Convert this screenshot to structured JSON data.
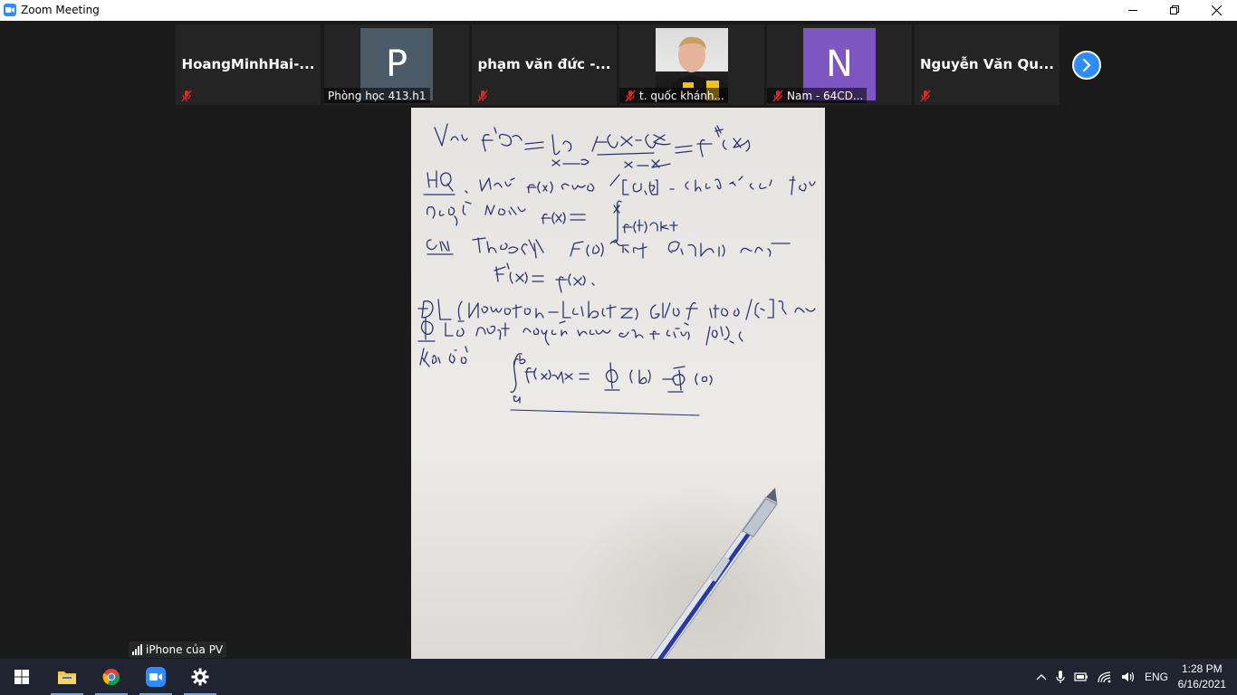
{
  "window": {
    "title": "Zoom Meeting"
  },
  "participants": [
    {
      "name": "HoangMinhHai-...",
      "type": "name",
      "label": ""
    },
    {
      "name": "Phòng học 413.h1",
      "type": "avatar",
      "initial": "P",
      "avatar_color": "#4a5a67",
      "label": "Phòng học 413.h1"
    },
    {
      "name": "phạm văn đức -...",
      "type": "name",
      "label": ""
    },
    {
      "name": "t. quốc khánh...",
      "type": "video",
      "label": "t. quốc khánh..."
    },
    {
      "name": "Nam - 64CD...",
      "type": "avatar",
      "initial": "N",
      "avatar_color": "#7d56c2",
      "label": "Nam - 64CD..."
    },
    {
      "name": "Nguyễn Văn Qu...",
      "type": "name",
      "label": ""
    }
  ],
  "share": {
    "label": "iPhone của PV"
  },
  "taskbar": {
    "tray_language": "ENG",
    "time": "1:28 PM",
    "date": "6/16/2021"
  },
  "colors": {
    "accent": "#2d8cff",
    "mic_muted": "#e02828"
  }
}
